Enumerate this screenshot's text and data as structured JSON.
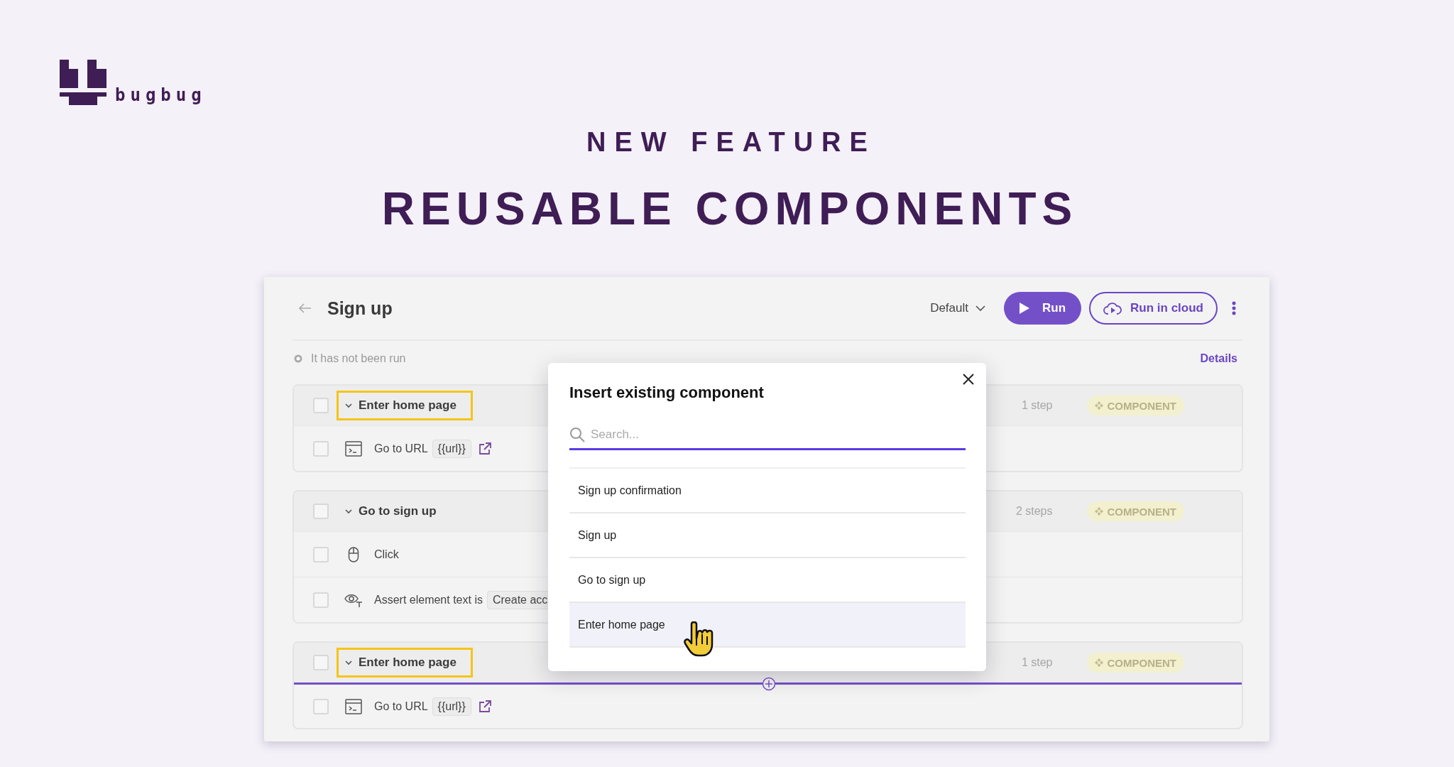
{
  "brand": {
    "name": "bugbug"
  },
  "hero": {
    "eyebrow": "NEW FEATURE",
    "title": "REUSABLE COMPONENTS"
  },
  "window": {
    "title": "Sign up",
    "profile": "Default",
    "run_button": "Run",
    "cloud_button": "Run in cloud",
    "status": "It has not been run",
    "details_link": "Details"
  },
  "groups": [
    {
      "title": "Enter home page",
      "checked": false,
      "expanded": true,
      "highlighted": true,
      "count": "1 step",
      "badge": "COMPONENT",
      "insert_line": false,
      "steps": [
        {
          "kind": "goto",
          "checked": false,
          "label": "Go to URL",
          "value": "{{url}}"
        }
      ]
    },
    {
      "title": "Go to sign up",
      "checked": false,
      "expanded": true,
      "highlighted": false,
      "count": "2 steps",
      "badge": "COMPONENT",
      "insert_line": false,
      "steps": [
        {
          "kind": "click",
          "checked": false,
          "label": "Click"
        },
        {
          "kind": "assert",
          "checked": false,
          "label": "Assert element text is",
          "value": "Create acc"
        }
      ]
    },
    {
      "title": "Enter home page",
      "checked": false,
      "expanded": true,
      "highlighted": true,
      "count": "1 step",
      "badge": "COMPONENT",
      "insert_line": true,
      "steps": [
        {
          "kind": "goto",
          "checked": false,
          "label": "Go to URL",
          "value": "{{url}}"
        }
      ]
    }
  ],
  "modal": {
    "title": "Insert existing component",
    "search": {
      "placeholder": "Search..."
    },
    "items": [
      {
        "label": "Sign up confirmation",
        "selected": false
      },
      {
        "label": "Sign up",
        "selected": false
      },
      {
        "label": "Go to sign up",
        "selected": false
      },
      {
        "label": "Enter home page",
        "selected": true
      }
    ]
  }
}
